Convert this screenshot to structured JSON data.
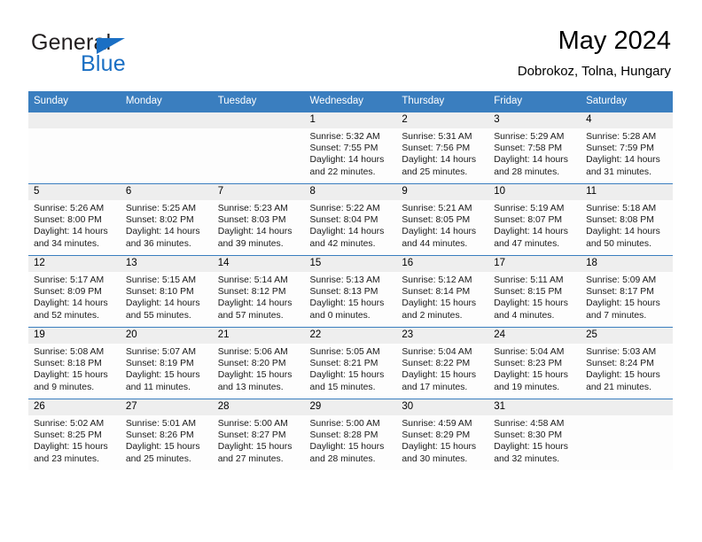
{
  "brand": {
    "word1": "General",
    "word2": "Blue",
    "triangle_color": "#1a6fc4"
  },
  "header": {
    "title": "May 2024",
    "subtitle": "Dobrokoz, Tolna, Hungary",
    "header_bg": "#3a7ebf",
    "daynum_bg": "#eeeeee"
  },
  "weekdays": [
    "Sunday",
    "Monday",
    "Tuesday",
    "Wednesday",
    "Thursday",
    "Friday",
    "Saturday"
  ],
  "labels": {
    "sunrise": "Sunrise:",
    "sunset": "Sunset:",
    "daylight": "Daylight:"
  },
  "weeks": [
    [
      {
        "day": "",
        "blank": true
      },
      {
        "day": "",
        "blank": true
      },
      {
        "day": "",
        "blank": true
      },
      {
        "day": "1",
        "sunrise": "Sunrise: 5:32 AM",
        "sunset": "Sunset: 7:55 PM",
        "daylight1": "Daylight: 14 hours",
        "daylight2": "and 22 minutes."
      },
      {
        "day": "2",
        "sunrise": "Sunrise: 5:31 AM",
        "sunset": "Sunset: 7:56 PM",
        "daylight1": "Daylight: 14 hours",
        "daylight2": "and 25 minutes."
      },
      {
        "day": "3",
        "sunrise": "Sunrise: 5:29 AM",
        "sunset": "Sunset: 7:58 PM",
        "daylight1": "Daylight: 14 hours",
        "daylight2": "and 28 minutes."
      },
      {
        "day": "4",
        "sunrise": "Sunrise: 5:28 AM",
        "sunset": "Sunset: 7:59 PM",
        "daylight1": "Daylight: 14 hours",
        "daylight2": "and 31 minutes."
      }
    ],
    [
      {
        "day": "5",
        "sunrise": "Sunrise: 5:26 AM",
        "sunset": "Sunset: 8:00 PM",
        "daylight1": "Daylight: 14 hours",
        "daylight2": "and 34 minutes."
      },
      {
        "day": "6",
        "sunrise": "Sunrise: 5:25 AM",
        "sunset": "Sunset: 8:02 PM",
        "daylight1": "Daylight: 14 hours",
        "daylight2": "and 36 minutes."
      },
      {
        "day": "7",
        "sunrise": "Sunrise: 5:23 AM",
        "sunset": "Sunset: 8:03 PM",
        "daylight1": "Daylight: 14 hours",
        "daylight2": "and 39 minutes."
      },
      {
        "day": "8",
        "sunrise": "Sunrise: 5:22 AM",
        "sunset": "Sunset: 8:04 PM",
        "daylight1": "Daylight: 14 hours",
        "daylight2": "and 42 minutes."
      },
      {
        "day": "9",
        "sunrise": "Sunrise: 5:21 AM",
        "sunset": "Sunset: 8:05 PM",
        "daylight1": "Daylight: 14 hours",
        "daylight2": "and 44 minutes."
      },
      {
        "day": "10",
        "sunrise": "Sunrise: 5:19 AM",
        "sunset": "Sunset: 8:07 PM",
        "daylight1": "Daylight: 14 hours",
        "daylight2": "and 47 minutes."
      },
      {
        "day": "11",
        "sunrise": "Sunrise: 5:18 AM",
        "sunset": "Sunset: 8:08 PM",
        "daylight1": "Daylight: 14 hours",
        "daylight2": "and 50 minutes."
      }
    ],
    [
      {
        "day": "12",
        "sunrise": "Sunrise: 5:17 AM",
        "sunset": "Sunset: 8:09 PM",
        "daylight1": "Daylight: 14 hours",
        "daylight2": "and 52 minutes."
      },
      {
        "day": "13",
        "sunrise": "Sunrise: 5:15 AM",
        "sunset": "Sunset: 8:10 PM",
        "daylight1": "Daylight: 14 hours",
        "daylight2": "and 55 minutes."
      },
      {
        "day": "14",
        "sunrise": "Sunrise: 5:14 AM",
        "sunset": "Sunset: 8:12 PM",
        "daylight1": "Daylight: 14 hours",
        "daylight2": "and 57 minutes."
      },
      {
        "day": "15",
        "sunrise": "Sunrise: 5:13 AM",
        "sunset": "Sunset: 8:13 PM",
        "daylight1": "Daylight: 15 hours",
        "daylight2": "and 0 minutes."
      },
      {
        "day": "16",
        "sunrise": "Sunrise: 5:12 AM",
        "sunset": "Sunset: 8:14 PM",
        "daylight1": "Daylight: 15 hours",
        "daylight2": "and 2 minutes."
      },
      {
        "day": "17",
        "sunrise": "Sunrise: 5:11 AM",
        "sunset": "Sunset: 8:15 PM",
        "daylight1": "Daylight: 15 hours",
        "daylight2": "and 4 minutes."
      },
      {
        "day": "18",
        "sunrise": "Sunrise: 5:09 AM",
        "sunset": "Sunset: 8:17 PM",
        "daylight1": "Daylight: 15 hours",
        "daylight2": "and 7 minutes."
      }
    ],
    [
      {
        "day": "19",
        "sunrise": "Sunrise: 5:08 AM",
        "sunset": "Sunset: 8:18 PM",
        "daylight1": "Daylight: 15 hours",
        "daylight2": "and 9 minutes."
      },
      {
        "day": "20",
        "sunrise": "Sunrise: 5:07 AM",
        "sunset": "Sunset: 8:19 PM",
        "daylight1": "Daylight: 15 hours",
        "daylight2": "and 11 minutes."
      },
      {
        "day": "21",
        "sunrise": "Sunrise: 5:06 AM",
        "sunset": "Sunset: 8:20 PM",
        "daylight1": "Daylight: 15 hours",
        "daylight2": "and 13 minutes."
      },
      {
        "day": "22",
        "sunrise": "Sunrise: 5:05 AM",
        "sunset": "Sunset: 8:21 PM",
        "daylight1": "Daylight: 15 hours",
        "daylight2": "and 15 minutes."
      },
      {
        "day": "23",
        "sunrise": "Sunrise: 5:04 AM",
        "sunset": "Sunset: 8:22 PM",
        "daylight1": "Daylight: 15 hours",
        "daylight2": "and 17 minutes."
      },
      {
        "day": "24",
        "sunrise": "Sunrise: 5:04 AM",
        "sunset": "Sunset: 8:23 PM",
        "daylight1": "Daylight: 15 hours",
        "daylight2": "and 19 minutes."
      },
      {
        "day": "25",
        "sunrise": "Sunrise: 5:03 AM",
        "sunset": "Sunset: 8:24 PM",
        "daylight1": "Daylight: 15 hours",
        "daylight2": "and 21 minutes."
      }
    ],
    [
      {
        "day": "26",
        "sunrise": "Sunrise: 5:02 AM",
        "sunset": "Sunset: 8:25 PM",
        "daylight1": "Daylight: 15 hours",
        "daylight2": "and 23 minutes."
      },
      {
        "day": "27",
        "sunrise": "Sunrise: 5:01 AM",
        "sunset": "Sunset: 8:26 PM",
        "daylight1": "Daylight: 15 hours",
        "daylight2": "and 25 minutes."
      },
      {
        "day": "28",
        "sunrise": "Sunrise: 5:00 AM",
        "sunset": "Sunset: 8:27 PM",
        "daylight1": "Daylight: 15 hours",
        "daylight2": "and 27 minutes."
      },
      {
        "day": "29",
        "sunrise": "Sunrise: 5:00 AM",
        "sunset": "Sunset: 8:28 PM",
        "daylight1": "Daylight: 15 hours",
        "daylight2": "and 28 minutes."
      },
      {
        "day": "30",
        "sunrise": "Sunrise: 4:59 AM",
        "sunset": "Sunset: 8:29 PM",
        "daylight1": "Daylight: 15 hours",
        "daylight2": "and 30 minutes."
      },
      {
        "day": "31",
        "sunrise": "Sunrise: 4:58 AM",
        "sunset": "Sunset: 8:30 PM",
        "daylight1": "Daylight: 15 hours",
        "daylight2": "and 32 minutes."
      },
      {
        "day": "",
        "blank": true
      }
    ]
  ]
}
